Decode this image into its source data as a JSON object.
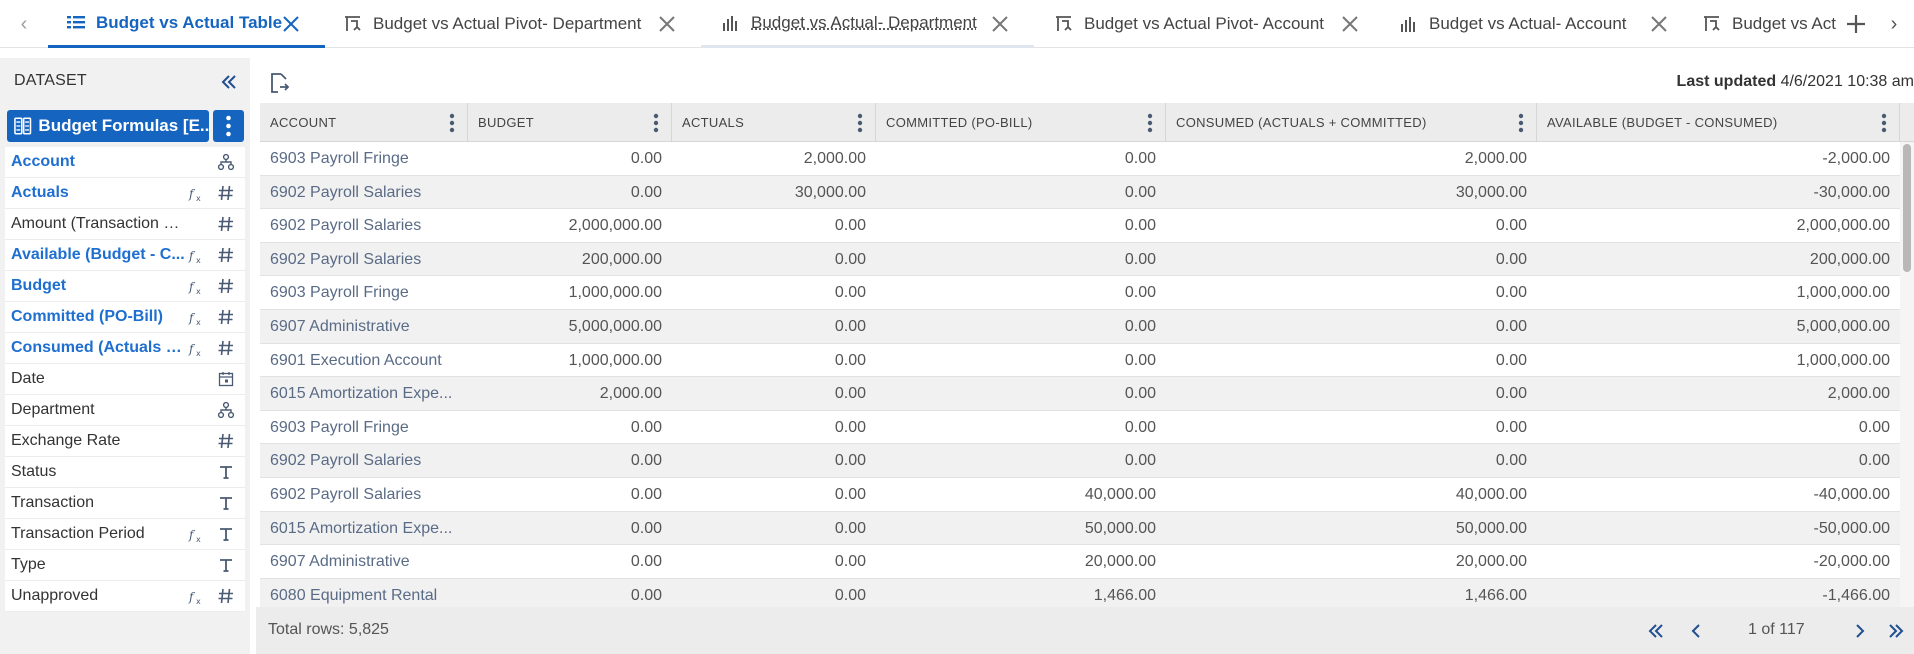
{
  "tabs": [
    {
      "label": "Budget vs Actual Table",
      "icon": "table-icon",
      "active": true
    },
    {
      "label": "Budget vs Actual Pivot- Department",
      "icon": "pivot-icon"
    },
    {
      "label": "Budget vs Actual- Department",
      "icon": "bar-chart-icon",
      "dimmed": true
    },
    {
      "label": "Budget vs Actual Pivot- Account",
      "icon": "pivot-icon"
    },
    {
      "label": "Budget vs Actual- Account",
      "icon": "bar-chart-icon"
    },
    {
      "label": "Budget vs Act",
      "icon": "pivot-icon"
    }
  ],
  "sidebar": {
    "header": "DATASET",
    "dataset_label": "Budget Formulas [E...",
    "fields": [
      {
        "label": "Account",
        "formula": true,
        "fx": false,
        "type": "hierarchy"
      },
      {
        "label": "Actuals",
        "formula": true,
        "fx": true,
        "type": "number"
      },
      {
        "label": "Amount (Transaction Cur...",
        "formula": false,
        "fx": false,
        "type": "number"
      },
      {
        "label": "Available (Budget - C...",
        "formula": true,
        "fx": true,
        "type": "number"
      },
      {
        "label": "Budget",
        "formula": true,
        "fx": true,
        "type": "number"
      },
      {
        "label": "Committed (PO-Bill)",
        "formula": true,
        "fx": true,
        "type": "number"
      },
      {
        "label": "Consumed (Actuals +...",
        "formula": true,
        "fx": true,
        "type": "number"
      },
      {
        "label": "Date",
        "formula": false,
        "fx": false,
        "type": "date"
      },
      {
        "label": "Department",
        "formula": false,
        "fx": false,
        "type": "hierarchy"
      },
      {
        "label": "Exchange Rate",
        "formula": false,
        "fx": false,
        "type": "number"
      },
      {
        "label": "Status",
        "formula": false,
        "fx": false,
        "type": "text"
      },
      {
        "label": "Transaction",
        "formula": false,
        "fx": false,
        "type": "text"
      },
      {
        "label": "Transaction Period",
        "formula": false,
        "fx": true,
        "type": "text"
      },
      {
        "label": "Type",
        "formula": false,
        "fx": false,
        "type": "text"
      },
      {
        "label": "Unapproved",
        "formula": false,
        "fx": true,
        "type": "number"
      }
    ]
  },
  "main": {
    "last_updated_label": "Last updated",
    "last_updated_value": "4/6/2021 10:38 am",
    "columns": [
      "ACCOUNT",
      "BUDGET",
      "ACTUALS",
      "COMMITTED (PO-BILL)",
      "CONSUMED (ACTUALS + COMMITTED)",
      "AVAILABLE (BUDGET - CONSUMED)"
    ],
    "rows": [
      [
        "6903 Payroll Fringe",
        "0.00",
        "2,000.00",
        "0.00",
        "2,000.00",
        "-2,000.00"
      ],
      [
        "6902 Payroll Salaries",
        "0.00",
        "30,000.00",
        "0.00",
        "30,000.00",
        "-30,000.00"
      ],
      [
        "6902 Payroll Salaries",
        "2,000,000.00",
        "0.00",
        "0.00",
        "0.00",
        "2,000,000.00"
      ],
      [
        "6902 Payroll Salaries",
        "200,000.00",
        "0.00",
        "0.00",
        "0.00",
        "200,000.00"
      ],
      [
        "6903 Payroll Fringe",
        "1,000,000.00",
        "0.00",
        "0.00",
        "0.00",
        "1,000,000.00"
      ],
      [
        "6907 Administrative",
        "5,000,000.00",
        "0.00",
        "0.00",
        "0.00",
        "5,000,000.00"
      ],
      [
        "6901 Execution Account",
        "1,000,000.00",
        "0.00",
        "0.00",
        "0.00",
        "1,000,000.00"
      ],
      [
        "6015 Amortization Expe...",
        "2,000.00",
        "0.00",
        "0.00",
        "0.00",
        "2,000.00"
      ],
      [
        "6903 Payroll Fringe",
        "0.00",
        "0.00",
        "0.00",
        "0.00",
        "0.00"
      ],
      [
        "6902 Payroll Salaries",
        "0.00",
        "0.00",
        "0.00",
        "0.00",
        "0.00"
      ],
      [
        "6902 Payroll Salaries",
        "0.00",
        "0.00",
        "40,000.00",
        "40,000.00",
        "-40,000.00"
      ],
      [
        "6015 Amortization Expe...",
        "0.00",
        "0.00",
        "50,000.00",
        "50,000.00",
        "-50,000.00"
      ],
      [
        "6907 Administrative",
        "0.00",
        "0.00",
        "20,000.00",
        "20,000.00",
        "-20,000.00"
      ],
      [
        "6080 Equipment Rental",
        "0.00",
        "0.00",
        "1,466.00",
        "1,466.00",
        "-1,466.00"
      ]
    ],
    "total_rows": "Total rows: 5,825",
    "page_info": "1 of 117"
  },
  "colors": {
    "accent": "#1565c0",
    "formula_text": "#1e6fd0",
    "account_text": "#5a6b86"
  }
}
